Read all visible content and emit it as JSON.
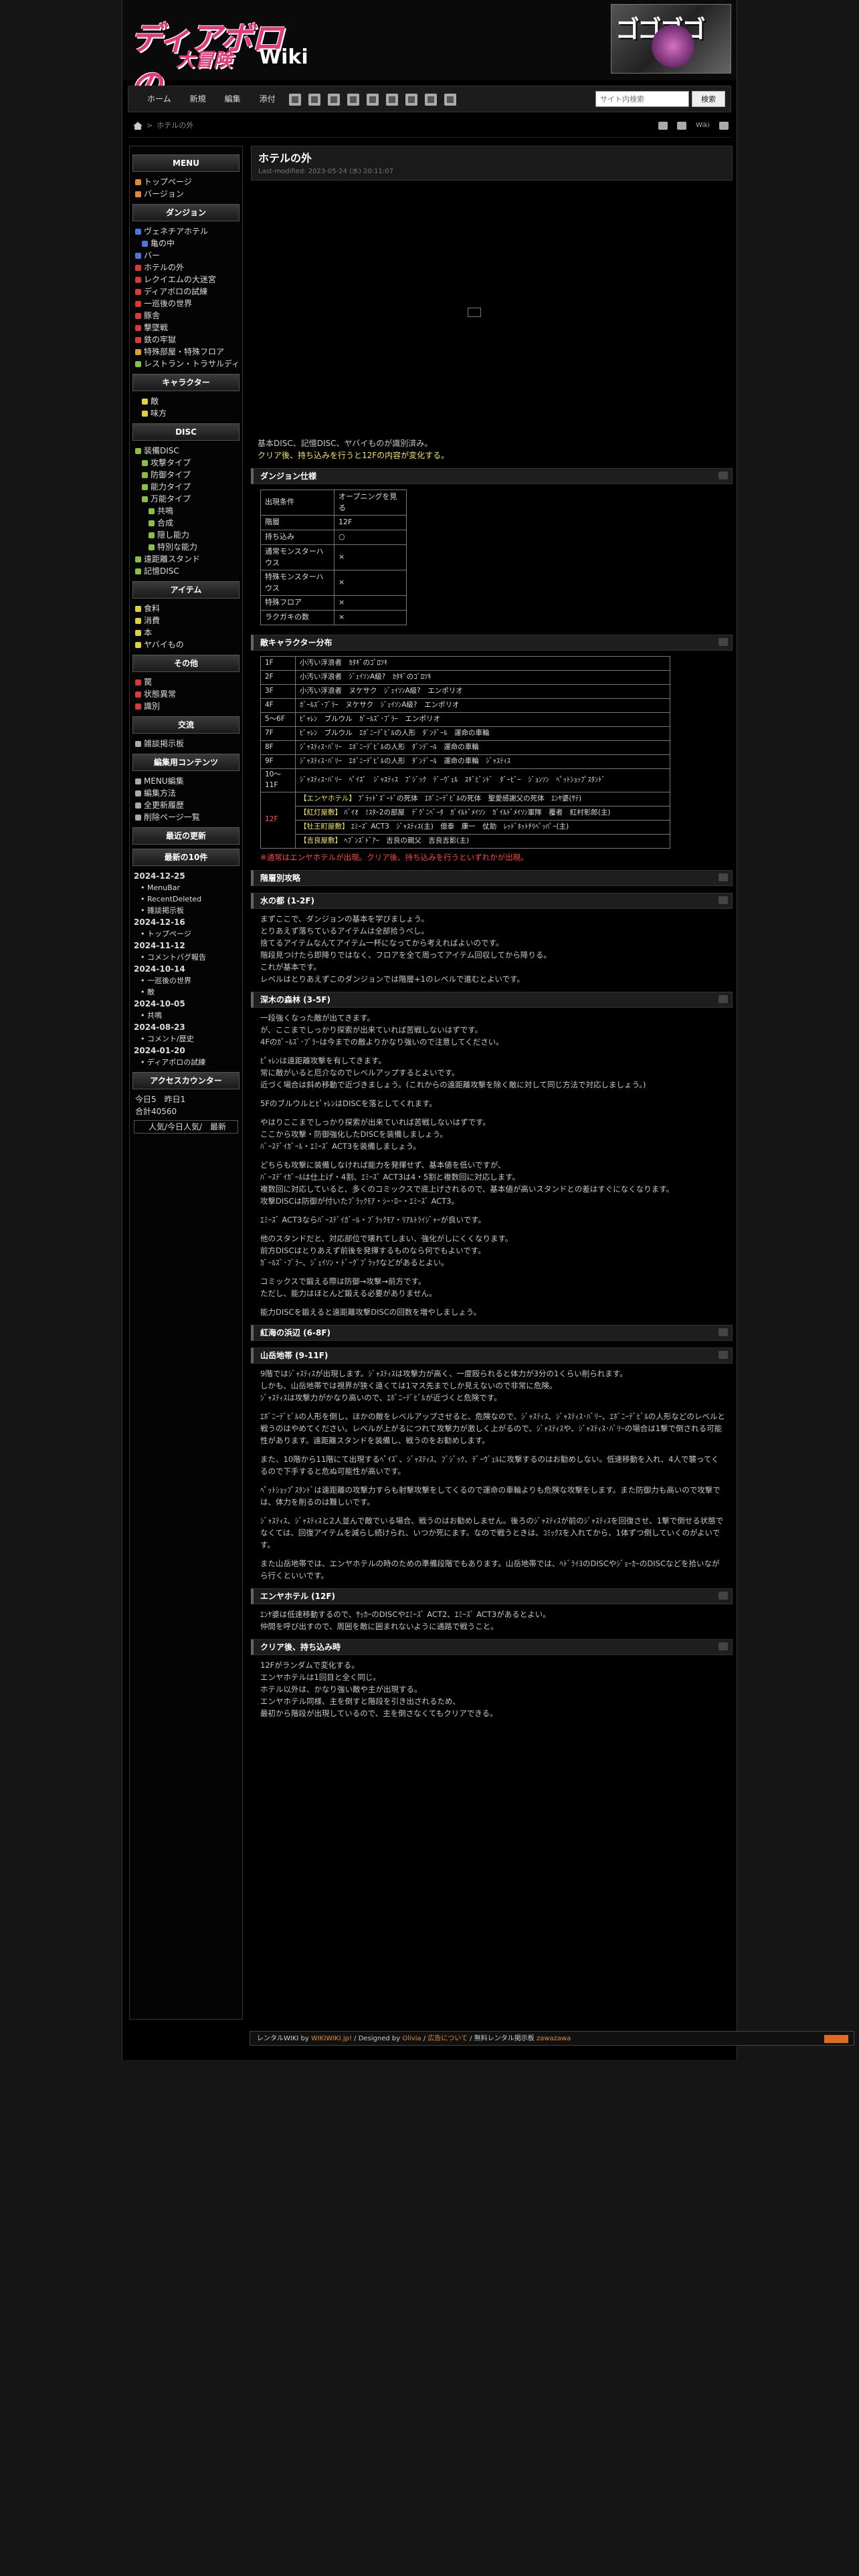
{
  "header": {
    "logo_line1": "ディアボロの",
    "logo_line2": "大冒険",
    "logo_wiki": "Wiki",
    "banner": "ゴゴゴゴ"
  },
  "nav": [
    "ホーム",
    "新規",
    "編集",
    "添付"
  ],
  "search": {
    "placeholder": "サイト内検索",
    "button": "検索"
  },
  "breadcrumb": {
    "current": "ホテルの外"
  },
  "toolbar_right": {
    "wiki": "Wiki"
  },
  "page": {
    "title": "ホテルの外",
    "modified": "Last-modified: 2023-05-24 (水) 20:11:07",
    "intro_1": "基本DISC、記憶DISC、ヤバイものが識別済み。",
    "intro_2": "クリア後、持ち込みを行うと12Fの内容が変化する。"
  },
  "sections": {
    "dungeon": "ダンジョン仕様",
    "enemy": "敵キャラクター分布",
    "strategy": "階層別攻略",
    "water": "水の都 (1-2F)",
    "forest": "深木の森林 (3-5F)",
    "red": "紅海の浜辺 (6-8F)",
    "mountain": "山岳地帯 (9-11F)",
    "hotel": "エンヤホテル (12F)",
    "clear": "クリア後、持ち込み時"
  },
  "spec": [
    [
      "出現条件",
      "オープニングを見る"
    ],
    [
      "階層",
      "12F"
    ],
    [
      "持ち込み",
      "○"
    ],
    [
      "通常モンスターハウス",
      "×"
    ],
    [
      "特殊モンスターハウス",
      "×"
    ],
    [
      "特殊フロア",
      "×"
    ],
    [
      "ラクガキの数",
      "×"
    ]
  ],
  "enemies": [
    [
      "1F",
      "小汚い浮浪者　ｶﾀｷﾞのｺﾞﾛﾂｷ"
    ],
    [
      "2F",
      "小汚い浮浪者　ｼﾞｪｲｿﾝA級?　ｶﾀｷﾞのｺﾞﾛﾂｷ"
    ],
    [
      "3F",
      "小汚い浮浪者　ヌケサク　ｼﾞｪｲｿﾝA級?　エンポリオ"
    ],
    [
      "4F",
      "ｶﾞｰﾙｽﾞ･ﾌﾞﾗｰ　ヌケサク　ｼﾞｪｲｿﾝA級?　エンポリオ"
    ],
    [
      "5〜6F",
      "ﾋﾟｬﾚﾝ　ブルウル　ｶﾞｰﾙｽﾞ･ﾌﾞﾗｰ　エンポリオ"
    ],
    [
      "7F",
      "ﾋﾟｬﾚﾝ　ブルウル　ｴﾎﾞﾆｰﾃﾞﾋﾞﾙの人形　ﾀﾞﾝﾃﾞｰﾙ　運命の車輪"
    ],
    [
      "8F",
      "ｼﾞｬｽﾃｨｽ･ﾊﾞﾘｰ　ｴﾎﾞﾆｰﾃﾞﾋﾞﾙの人形　ﾀﾞﾝﾃﾞｰﾙ　運命の車輪"
    ],
    [
      "9F",
      "ｼﾞｬｽﾃｨｽ･ﾊﾞﾘｰ　ｴﾎﾞﾆｰﾃﾞﾋﾞﾙの人形　ﾀﾞﾝﾃﾞｰﾙ　運命の車輪　ｼﾞｬｽﾃｨｽ"
    ],
    [
      "10〜11F",
      "ｼﾞｬｽﾃｨｽ･ﾊﾞﾘｰ　ﾍﾟｲｽﾞ　ｼﾞｬｽﾃｨｽ　ﾌﾞｼﾞｯｸ　ﾃﾞｰｳﾞｪﾙ　ｽｷﾞﾋﾞﾝﾄﾞ　ﾀﾞｰﾋﾞｰ　ｼﾞｮﾝｿﾝ　ﾍﾟｯﾄｼｮｯﾌﾟｽﾀﾝﾄﾞ"
    ]
  ],
  "floor12": {
    "label": "12F",
    "rows": [
      [
        "【エンヤホテル】",
        "ﾌﾞﾗｯﾄﾞｽﾞｰﾄﾞの死体　ｴﾎﾞﾆｰﾃﾞﾋﾞﾙの死体　聖愛感謝父の死体　ｴﾝﾔ婆(ｻﾃ)"
      ],
      [
        "【紅灯屋敷】",
        "ﾊﾞｲｵ　ﾐｽﾀｰ2の部屋　ﾃﾞｸﾞﾆﾍﾞｰﾀ　ｶﾞｲﾙﾄﾞﾒｲｿﾝ　ｶﾞｲﾙﾄﾞﾒｲｿﾝ軍隊　覆者　紅村彰郎(主)"
      ],
      [
        "【牡王町屋敷】",
        "ｴﾐｰｽﾞ ACT3　ｼﾞｬｽﾃｨｽ(主)　億泰　康一　仗助　ﾚｯﾄﾞﾎｯﾄﾁﾘﾍﾟｯﾊﾟｰ(主)"
      ],
      [
        "【吉良屋敷】",
        "ﾍﾌﾞﾝｽﾞﾄﾞｱｰ　吉良の親父　吉良吉影(主)"
      ]
    ]
  },
  "enemy_note_1": "※通常はエンヤホテルが出現。",
  "enemy_note_2": "クリア後、持ち込みを行うといずれかが出現。",
  "water_text": [
    "まずここで、ダンジョンの基本を学びましょう。",
    "とりあえず落ちているアイテムは全部拾うべし。",
    "捨てるアイテムなんてアイテム一杯になってから考えればよいのです。",
    "階段見つけたら即降りではなく、フロアを全て周ってアイテム回収してから降りる。",
    "これが基本です。",
    "レベルはとりあえずこのダンジョンでは階層+1のレベルで進むとよいです。"
  ],
  "forest_text": [
    "一段強くなった敵が出てきます。",
    "が、ここまでしっかり探索が出来ていれば苦戦しないはずです。",
    "4Fのｶﾞｰﾙｽﾞ･ﾌﾞﾗｰは今までの敵よりかなり強いので注意してください。",
    "ﾋﾟｬﾚﾝは遠距離攻撃を有してきます。",
    "常に敵がいると厄介なのでレベルアップするとよいです。",
    "近づく場合は斜め移動で近づきましょう。(これからの遠距離攻撃を除く敵に対して同じ方法で対応しましょう。)",
    "5FのブルウルとﾋﾟｬﾚﾝはDISCを落としてくれます。",
    "やはりここまでしっかり探索が出来ていれば苦戦しないはずです。",
    "ここから攻撃・防御強化したDISCを装備しましょう。",
    "ﾊﾞｰｽﾃﾞｲｶﾞｰﾙ・ｴﾐｰｽﾞ ACT3を装備しましょう。",
    "どちらも攻撃に装備しなければ能力を発揮せず、基本値を低いですが、",
    "ﾊﾞｰｽﾃﾞｲｶﾞｰﾙは仕上げ・4割、ｴﾐｰｽﾞ ACT3は4・5割と複数回に対応します。",
    "複数回に対応していると、多くのコミックスで底上げされるので、基本値が高いスタンドとの差はすぐになくなります。",
    "攻撃DISCは防御が付いたﾌﾞﾗｯｸﾓｱ・ｼｰ･ﾛｰ・ｴﾐｰｽﾞ ACT3。",
    "ｴﾐｰｽﾞ ACT3ならﾊﾞｰｽﾃﾞｲｶﾞｰﾙ・ﾌﾞﾗｯｸﾓｱ・ﾘｱﾙﾄﾗｲｼﾞｬｰが良いです。",
    "他のスタンドだと、対応部位で壊れてしまい、強化がしにくくなります。",
    "前方DISCはとりあえず前後を発揮するものなら何でもよいです。",
    "ｶﾞｰﾙｽﾞ･ﾌﾞﾗｰ、ｼﾞｪｲｿﾝ・ﾄﾞｰｸﾞﾌﾞﾗｯｸなどがあるとよい。",
    "コミックスで鍛える際は防御→攻撃→前方です。",
    "ただし、能力はほとんど鍛える必要がありません。",
    "能力DISCを鍛えると遠距離攻撃DISCの回数を増やしましょう。"
  ],
  "mountain_text": [
    "9階ではｼﾞｬｽﾃｨｽが出現します。ｼﾞｬｽﾃｨｽは攻撃力が高く、一度殴られると体力が3分の1くらい削られます。",
    "しかも、山岳地帯では視界が狭く遠くては1マス先までしか見えないので非常に危険。",
    "ｼﾞｬｽﾃｨｽは攻撃力がかなり高いので、ｴﾎﾞﾆｰﾃﾞﾋﾞﾙが近づくと危険です。",
    "ｴﾎﾞﾆｰﾃﾞﾋﾞﾙの人形を倒し、ほかの敵をレベルアップさせると、危険なので、ｼﾞｬｽﾃｨｽ、ｼﾞｬｽﾃｨｽ･ﾊﾞﾘｰ、ｴﾎﾞﾆｰﾃﾞﾋﾞﾙの人形などのレベルと戦うのはやめてください。レベルが上がるにつれて攻撃力が激しく上がるので、ｼﾞｬｽﾃｨｽや、ｼﾞｬｽﾃｨｽ･ﾊﾞﾘｰの場合は1撃で倒される可能性があります。遠距離スタンドを装備し、戦うのをお勧めします。",
    "また、10階から11階にて出現するﾍﾟｲｽﾞ、ｼﾞｬｽﾃｨｽ、ﾌﾞｼﾞｯｸ、ﾃﾞｰｳﾞｪﾙに攻撃するのはお勧めしない。低速移動を入れ、4人で襲ってくるので下手すると危ぬ可能性が高いです。",
    "ﾍﾟｯﾄｼｮｯﾌﾟｽﾀﾝﾄﾞは遠距離の攻撃力すらも射撃攻撃をしてくるので運命の車輪よりも危険な攻撃をします。また防御力も高いので攻撃では、体力を削るのは難しいです。",
    "ｼﾞｬｽﾃｨｽ、ｼﾞｬｽﾃｨｽと2人並んで敵でいる場合、戦うのはお勧めしません。後ろのｼﾞｬｽﾃｨｽが前のｼﾞｬｽﾃｨｽを回復させ、1撃で倒せる状態でなくては、回復アイテムを減らし続けられ、いつか死にます。なので戦うときは、ｺﾐｯｸｽを入れてから、1体ずつ倒していくのがよいです。",
    "また山岳地帯では、エンヤホテルの時のための準備段階でもあります。山岳地帯では、ﾍﾄﾞﾗｲﾖのDISCやｼﾞｮｰｶｰのDISCなどを拾いながら行くといいです。"
  ],
  "hotel_text": [
    "ｴﾝﾔ婆は低速移動するので、ｻｯｶｰのDISCやｴﾐｰｽﾞ ACT2、ｴﾐｰｽﾞ ACT3があるとよい。",
    "仲間を呼び出すので、周囲を敵に囲まれないように通路で戦うこと。"
  ],
  "clear_text": [
    "12Fがランダムで変化する。",
    "エンヤホテルは1回目と全く同じ。",
    "ホテル以外は、かなり強い敵や主が出現する。",
    "エンヤホテル同様、主を倒すと階段を引き出されるため、",
    "最初から階段が出現しているので、主を倒さなくてもクリアできる。"
  ],
  "sidebar": {
    "menu_h": "MENU",
    "menu": [
      "トップページ",
      "バージョン"
    ],
    "dungeon_h": "ダンジョン",
    "dungeon": [
      {
        "t": "ヴェネチアホテル",
        "lv": 0,
        "c": "#4a78d8"
      },
      {
        "t": "亀の中",
        "lv": 1,
        "c": "#4a78d8"
      },
      {
        "t": "バー",
        "lv": 0,
        "c": "#4a78d8"
      },
      {
        "t": "ホテルの外",
        "lv": 0,
        "c": "#d83a3a"
      },
      {
        "t": "レクイエムの大迷宮",
        "lv": 0,
        "c": "#d83a3a"
      },
      {
        "t": "ディアボロの試練",
        "lv": 0,
        "c": "#d83a3a"
      },
      {
        "t": "一巡後の世界",
        "lv": 0,
        "c": "#d83a3a"
      },
      {
        "t": "豚舎",
        "lv": 0,
        "c": "#d83a3a"
      },
      {
        "t": "撃墜戦",
        "lv": 0,
        "c": "#d83a3a"
      },
      {
        "t": "鉄の牢獄",
        "lv": 0,
        "c": "#d83a3a"
      },
      {
        "t": "特殊部屋・特殊フロア",
        "lv": 0,
        "c": "#d8a030"
      },
      {
        "t": "レストラン・トラサルディー",
        "lv": 0,
        "c": "#8ac040"
      }
    ],
    "chara_h": "キャラクター",
    "chara": [
      {
        "t": "敵",
        "c": "#e0d040"
      },
      {
        "t": "味方",
        "c": "#e0d040"
      }
    ],
    "disc_h": "DISC",
    "disc": [
      {
        "t": "装備DISC",
        "lv": 0
      },
      {
        "t": "攻撃タイプ",
        "lv": 1
      },
      {
        "t": "防御タイプ",
        "lv": 1
      },
      {
        "t": "能力タイプ",
        "lv": 1
      },
      {
        "t": "万能タイプ",
        "lv": 1
      },
      {
        "t": "共鳴",
        "lv": 2
      },
      {
        "t": "合成",
        "lv": 2
      },
      {
        "t": "隠し能力",
        "lv": 2
      },
      {
        "t": "特別な能力",
        "lv": 2
      },
      {
        "t": "遠距離スタンド",
        "lv": 0
      },
      {
        "t": "記憶DISC",
        "lv": 0
      }
    ],
    "item_h": "アイテム",
    "item": [
      "食料",
      "消費",
      "本",
      "ヤバイもの"
    ],
    "other_h": "その他",
    "other": [
      "罠",
      "状態異常",
      "識別"
    ],
    "talk_h": "交流",
    "talk": [
      "雑談掲示板"
    ],
    "edit_h": "編集用コンテンツ",
    "edit": [
      "MENU編集",
      "編集方法",
      "全更新履歴",
      "削除ページ一覧"
    ],
    "recent_h": "最近の更新",
    "recent10_h": "最新の10件",
    "recent": [
      {
        "d": "2024-12-25",
        "i": [
          "MenuBar",
          "RecentDeleted",
          "雑談掲示板"
        ]
      },
      {
        "d": "2024-12-16",
        "i": [
          "トップページ"
        ]
      },
      {
        "d": "2024-11-12",
        "i": [
          "コメントバグ報告"
        ]
      },
      {
        "d": "2024-10-14",
        "i": [
          "一巡後の世界",
          "敵"
        ]
      },
      {
        "d": "2024-10-05",
        "i": [
          "共鳴"
        ]
      },
      {
        "d": "2024-08-23",
        "i": [
          "コメント/歴史"
        ]
      },
      {
        "d": "2024-01-20",
        "i": [
          "ディアボロの試練"
        ]
      }
    ],
    "counter_h": "アクセスカウンター",
    "counter_1": "今日5　昨日1",
    "counter_2": "合計40560",
    "counter_btn": "人気/今日人気/　最新"
  },
  "footer": {
    "a": "レンタルWIKI by ",
    "b": "WIKIWIKI.jp!",
    "c": " / Designed by ",
    "d": "Olivia",
    "e": " / ",
    "f": "広告について",
    "g": " / 無料レンタル掲示板 ",
    "h": "zawazawa"
  }
}
